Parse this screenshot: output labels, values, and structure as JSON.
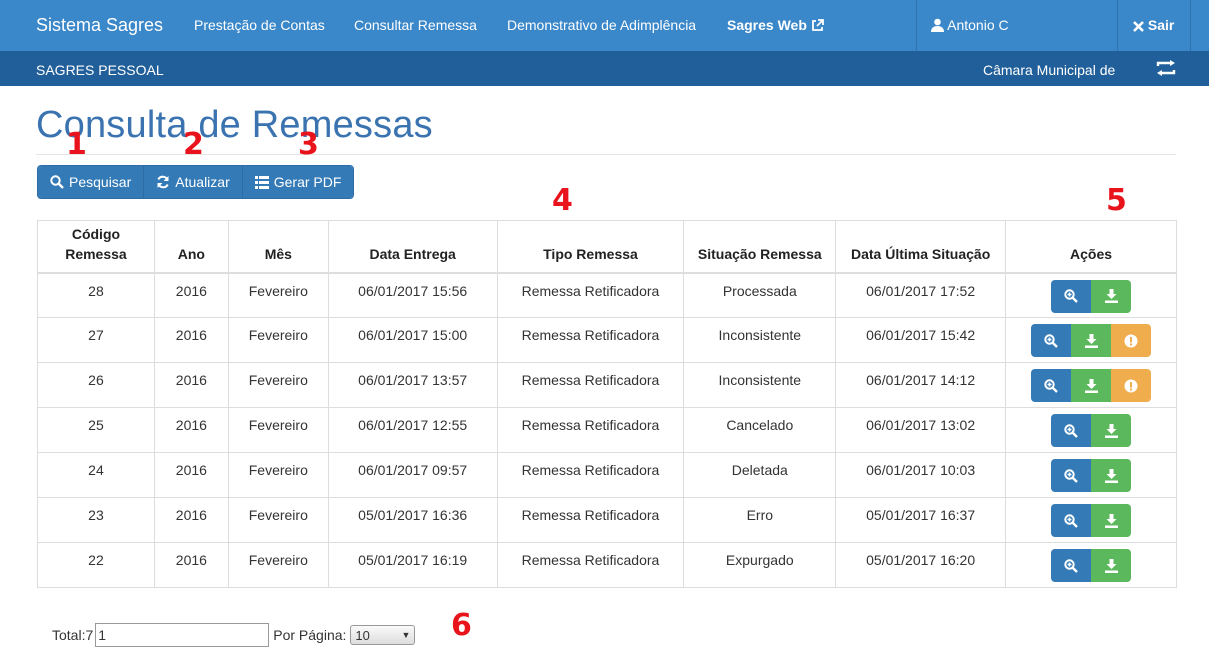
{
  "topnav": {
    "brand": "Sistema Sagres",
    "links": [
      "Prestação de Contas",
      "Consultar Remessa",
      "Demonstrativo de Adimplência"
    ],
    "sagres_web": "Sagres Web",
    "user": "Antonio C",
    "logout": "Sair"
  },
  "subnav": {
    "left": "SAGRES PESSOAL",
    "right": "Câmara Municipal de"
  },
  "page": {
    "title": "Consulta de Remessas"
  },
  "toolbar": {
    "search": "Pesquisar",
    "refresh": "Atualizar",
    "pdf": "Gerar PDF"
  },
  "markers": [
    "1",
    "2",
    "3",
    "4",
    "5",
    "6"
  ],
  "table": {
    "headers": {
      "codigo_line1": "Código",
      "codigo_line2": "Remessa",
      "ano": "Ano",
      "mes": "Mês",
      "data_entrega": "Data Entrega",
      "tipo": "Tipo Remessa",
      "situacao": "Situação Remessa",
      "data_ultima": "Data Última Situação",
      "acoes": "Ações"
    },
    "rows": [
      {
        "codigo": "28",
        "ano": "2016",
        "mes": "Fevereiro",
        "entrega": "06/01/2017 15:56",
        "tipo": "Remessa Retificadora",
        "situacao": "Processada",
        "ultima": "06/01/2017 17:52"
      },
      {
        "codigo": "27",
        "ano": "2016",
        "mes": "Fevereiro",
        "entrega": "06/01/2017 15:00",
        "tipo": "Remessa Retificadora",
        "situacao": "Inconsistente",
        "ultima": "06/01/2017 15:42"
      },
      {
        "codigo": "26",
        "ano": "2016",
        "mes": "Fevereiro",
        "entrega": "06/01/2017 13:57",
        "tipo": "Remessa Retificadora",
        "situacao": "Inconsistente",
        "ultima": "06/01/2017 14:12"
      },
      {
        "codigo": "25",
        "ano": "2016",
        "mes": "Fevereiro",
        "entrega": "06/01/2017 12:55",
        "tipo": "Remessa Retificadora",
        "situacao": "Cancelado",
        "ultima": "06/01/2017 13:02"
      },
      {
        "codigo": "24",
        "ano": "2016",
        "mes": "Fevereiro",
        "entrega": "06/01/2017 09:57",
        "tipo": "Remessa Retificadora",
        "situacao": "Deletada",
        "ultima": "06/01/2017 10:03"
      },
      {
        "codigo": "23",
        "ano": "2016",
        "mes": "Fevereiro",
        "entrega": "05/01/2017 16:36",
        "tipo": "Remessa Retificadora",
        "situacao": "Erro",
        "ultima": "05/01/2017 16:37"
      },
      {
        "codigo": "22",
        "ano": "2016",
        "mes": "Fevereiro",
        "entrega": "05/01/2017 16:19",
        "tipo": "Remessa Retificadora",
        "situacao": "Expurgado",
        "ultima": "05/01/2017 16:20"
      }
    ]
  },
  "footer": {
    "total_label": "Total:7",
    "page_value": "1",
    "per_page_label": "Por Página:",
    "per_page_value": "10"
  },
  "colors": {
    "topnav": "#3a87c9",
    "subnav": "#215f9a",
    "primary": "#337ab7",
    "success": "#5cb85c",
    "warning": "#f0ad4e",
    "marker": "#e8131b",
    "title": "#3a73b0"
  },
  "icons": {
    "external": "external-link-icon",
    "user": "user-icon",
    "logout": "close-icon",
    "swap": "swap-icon",
    "search": "search-icon",
    "refresh": "refresh-icon",
    "list": "list-icon",
    "view": "zoom-in-icon",
    "download": "download-icon",
    "warning": "exclamation-icon"
  }
}
